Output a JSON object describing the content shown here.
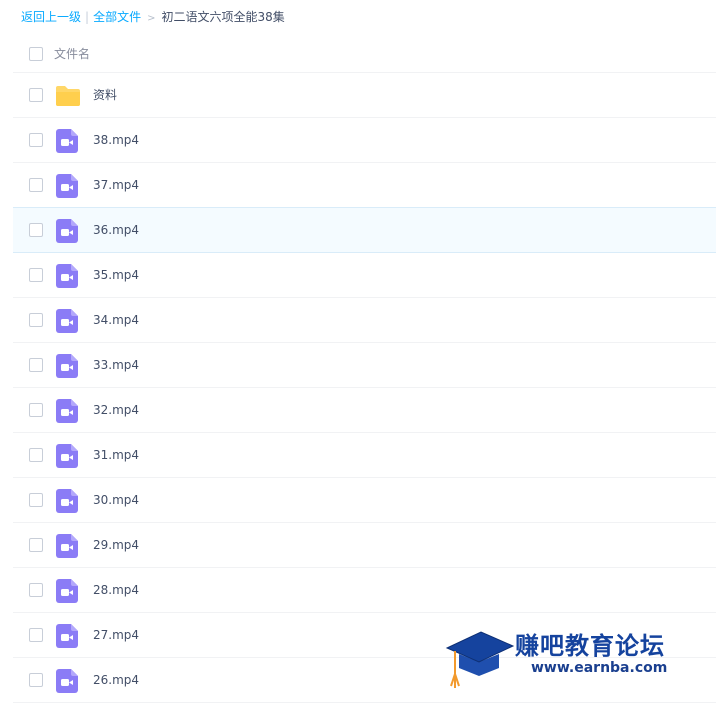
{
  "breadcrumb": {
    "back_label": "返回上一级",
    "separator": "|",
    "all_files_label": "全部文件",
    "arrow": ">",
    "current_folder": "初二语文六项全能38集"
  },
  "list": {
    "header_label": "文件名",
    "items": [
      {
        "name": "资料",
        "type": "folder",
        "selected": false
      },
      {
        "name": "38.mp4",
        "type": "video",
        "selected": false
      },
      {
        "name": "37.mp4",
        "type": "video",
        "selected": false
      },
      {
        "name": "36.mp4",
        "type": "video",
        "selected": true
      },
      {
        "name": "35.mp4",
        "type": "video",
        "selected": false
      },
      {
        "name": "34.mp4",
        "type": "video",
        "selected": false
      },
      {
        "name": "33.mp4",
        "type": "video",
        "selected": false
      },
      {
        "name": "32.mp4",
        "type": "video",
        "selected": false
      },
      {
        "name": "31.mp4",
        "type": "video",
        "selected": false
      },
      {
        "name": "30.mp4",
        "type": "video",
        "selected": false
      },
      {
        "name": "29.mp4",
        "type": "video",
        "selected": false
      },
      {
        "name": "28.mp4",
        "type": "video",
        "selected": false
      },
      {
        "name": "27.mp4",
        "type": "video",
        "selected": false
      },
      {
        "name": "26.mp4",
        "type": "video",
        "selected": false
      }
    ]
  },
  "watermark": {
    "title": "赚吧教育论坛",
    "url": "www.earnba.com"
  },
  "colors": {
    "link": "#09aaff",
    "folder": "#ffd768",
    "video": "#8b7cf6",
    "selected_bg": "#f4fbff",
    "watermark_blue": "#15439e"
  },
  "icons": {
    "folder": "folder-icon",
    "video": "video-file-icon",
    "checkbox": "checkbox"
  }
}
